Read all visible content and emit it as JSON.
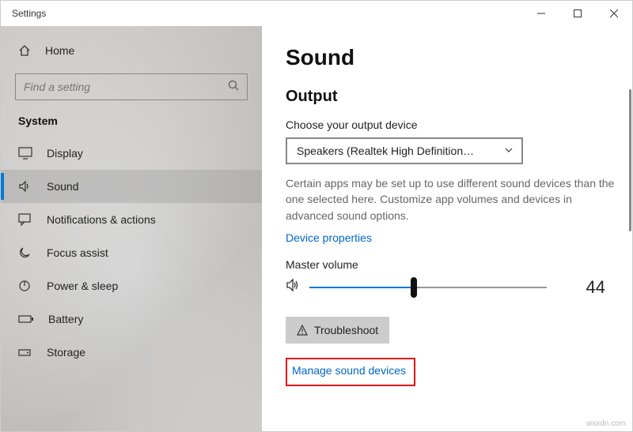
{
  "window": {
    "title": "Settings"
  },
  "sidebar": {
    "home": "Home",
    "search_placeholder": "Find a setting",
    "category": "System",
    "items": [
      {
        "label": "Display"
      },
      {
        "label": "Sound"
      },
      {
        "label": "Notifications & actions"
      },
      {
        "label": "Focus assist"
      },
      {
        "label": "Power & sleep"
      },
      {
        "label": "Battery"
      },
      {
        "label": "Storage"
      }
    ]
  },
  "main": {
    "title": "Sound",
    "output_heading": "Output",
    "choose_label": "Choose your output device",
    "device_selected": "Speakers (Realtek High Definition…",
    "desc": "Certain apps may be set up to use different sound devices than the one selected here. Customize app volumes and devices in advanced sound options.",
    "device_props_link": "Device properties",
    "master_volume_label": "Master volume",
    "volume_value": "44",
    "troubleshoot_label": "Troubleshoot",
    "manage_link": "Manage sound devices"
  },
  "watermark": "wsxdn.com"
}
